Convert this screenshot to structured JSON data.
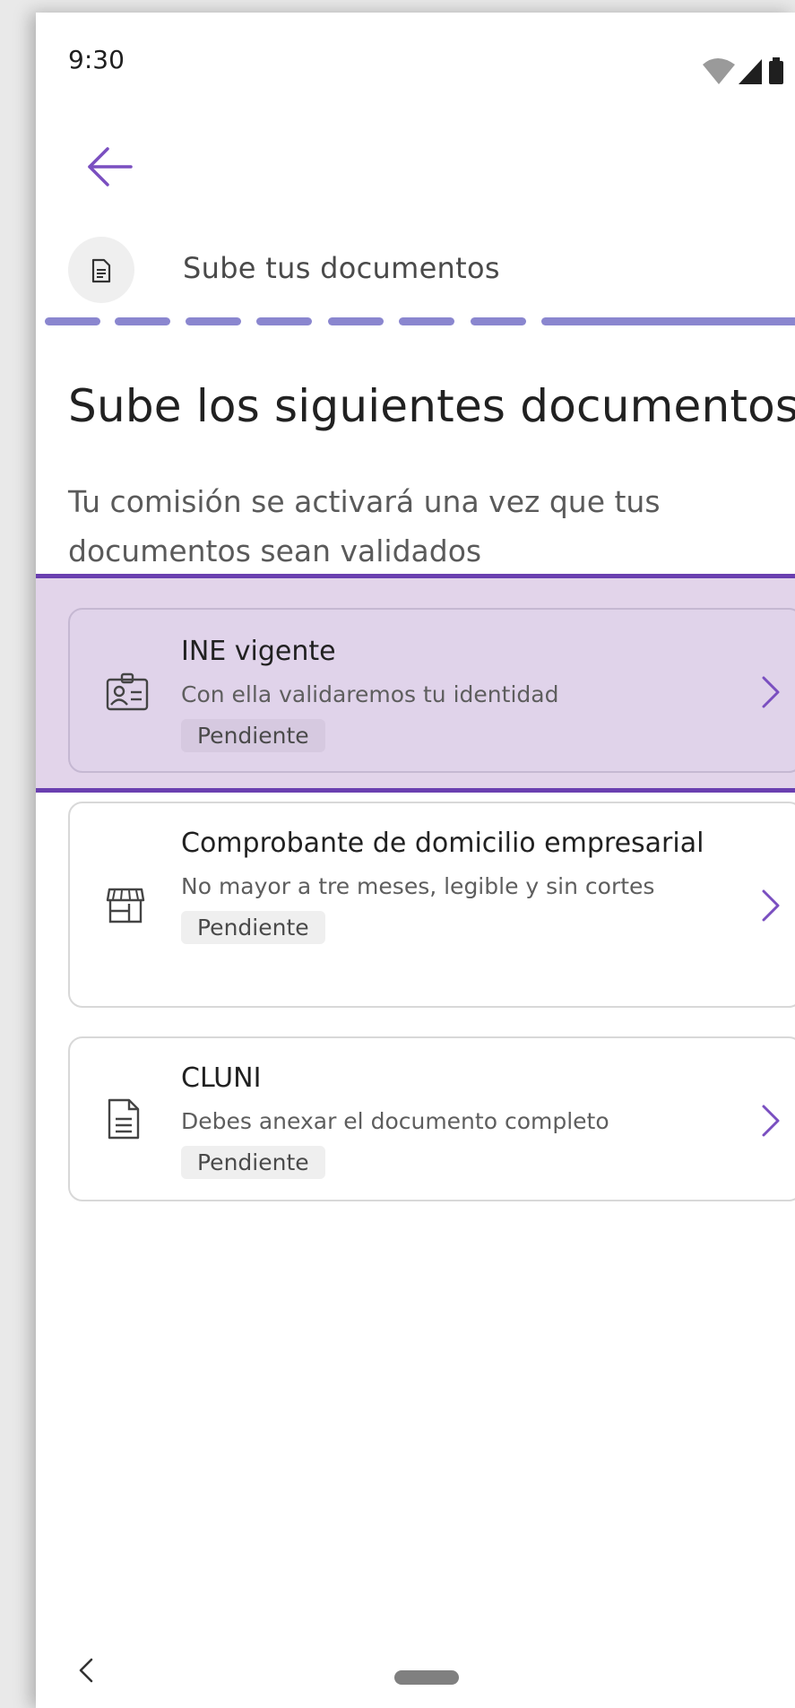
{
  "status_bar": {
    "time": "9:30"
  },
  "header": {
    "back_icon": "arrow-left-icon",
    "step_icon": "document-icon",
    "step_title": "Sube tus documentos"
  },
  "progress": {
    "total_steps": 8,
    "current_step": 8
  },
  "main": {
    "title": "Sube los siguientes documentos",
    "subtitle": "Tu comisión se activará una vez que tus documentos sean validados"
  },
  "documents": [
    {
      "title": "INE vigente",
      "description": "Con ella validaremos tu identidad",
      "status": "Pendiente",
      "icon": "id-card-icon",
      "selected": true
    },
    {
      "title": "Comprobante de domicilio empresarial",
      "description": "No mayor a tre meses, legible y sin cortes",
      "status": "Pendiente",
      "icon": "storefront-icon",
      "selected": false
    },
    {
      "title": "CLUNI",
      "description": "Debes anexar el documento completo",
      "status": "Pendiente",
      "icon": "document-icon",
      "selected": false
    }
  ],
  "colors": {
    "accent": "#6a3fb0",
    "progress": "#8a86cf",
    "selected_background": "#e0d3ea",
    "badge_background": "#efefef"
  }
}
